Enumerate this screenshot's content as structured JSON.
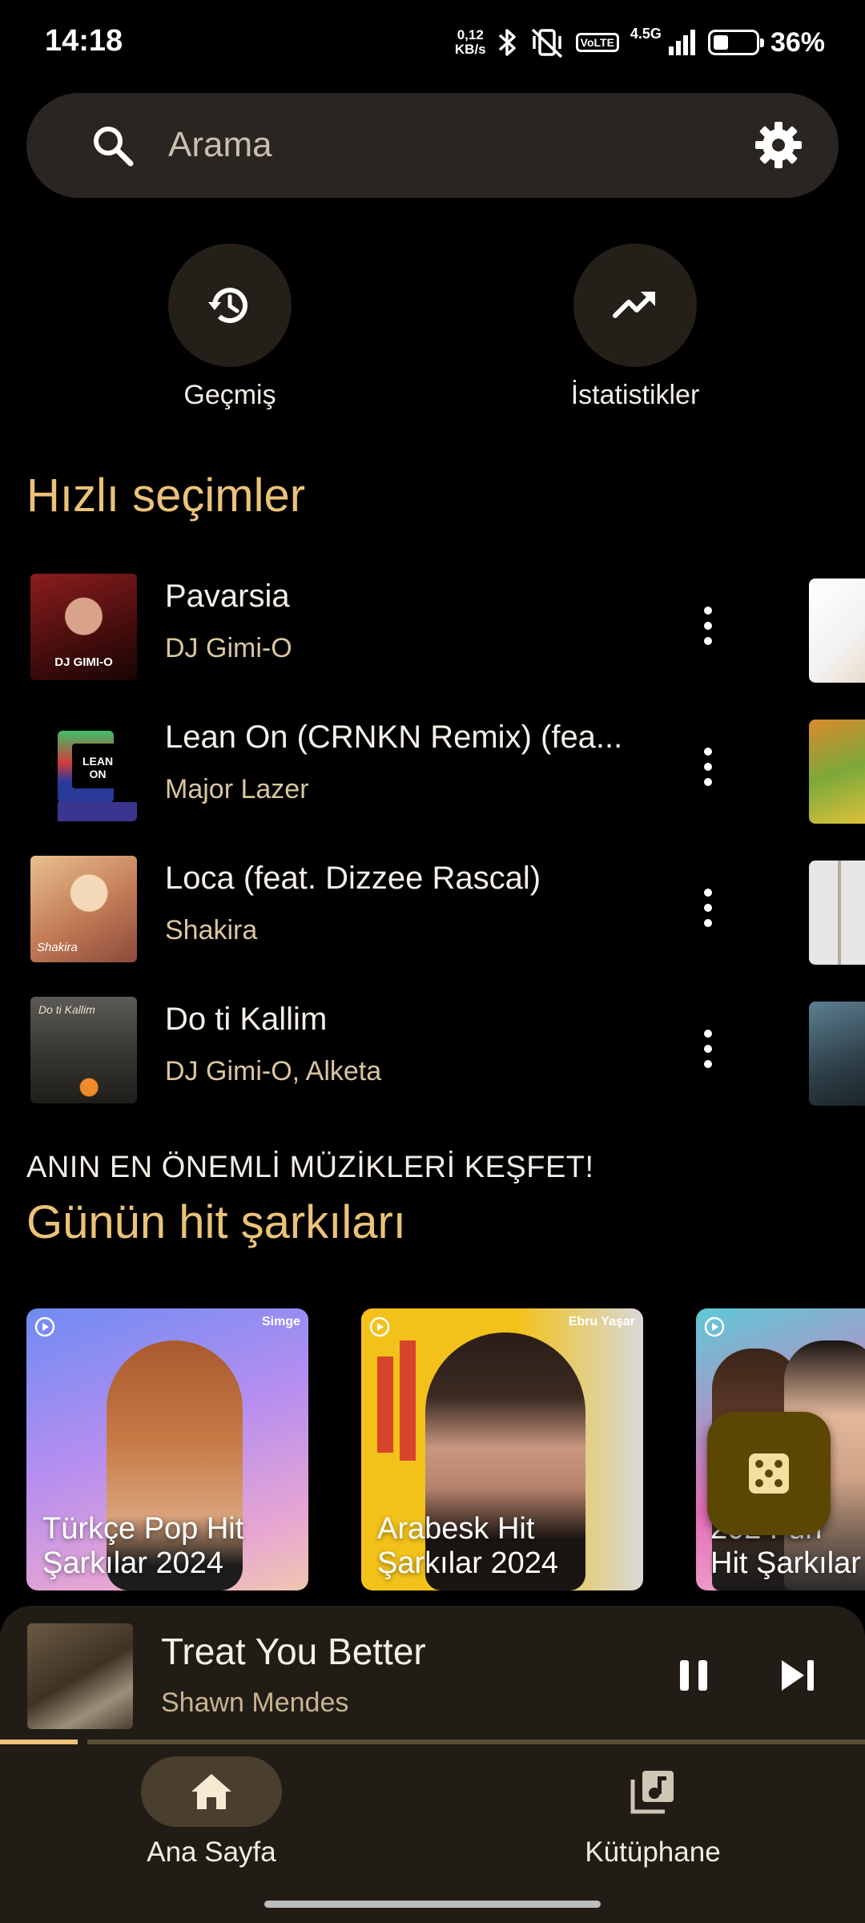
{
  "status_bar": {
    "time": "14:18",
    "net_speed_value": "0,12",
    "net_speed_unit": "KB/s",
    "volte_top": "Vo",
    "volte_bottom": "LTE",
    "network": "4.5G",
    "battery_percent": "36%",
    "battery_level": 0.36
  },
  "search": {
    "placeholder": "Arama"
  },
  "quick_actions": [
    {
      "label": "Geçmiş",
      "icon": "history-icon"
    },
    {
      "label": "İstatistikler",
      "icon": "trending-up-icon"
    }
  ],
  "quick_picks": {
    "title": "Hızlı seçimler",
    "items": [
      {
        "title": "Pavarsia",
        "artist": "DJ Gimi-O"
      },
      {
        "title": "Lean On (CRNKN Remix) (fea...",
        "artist": "Major Lazer"
      },
      {
        "title": "Loca (feat. Dizzee Rascal)",
        "artist": "Shakira"
      },
      {
        "title": "Do ti Kallim",
        "artist": "DJ Gimi-O, Alketa"
      }
    ]
  },
  "hits": {
    "kicker": "ANIN EN ÖNEMLİ MÜZİKLERİ KEŞFET!",
    "title": "Günün hit şarkıları",
    "cards": [
      {
        "title_line1": "Türkçe Pop Hit",
        "title_line2": "Şarkılar 2024",
        "artist": "Simge"
      },
      {
        "title_line1": "Arabesk Hit",
        "title_line2": "Şarkılar 2024",
        "artist": "Ebru Yaşar"
      },
      {
        "title_line1": "202 Fun",
        "title_line2": "Hit Şarkılar",
        "artist": ""
      }
    ]
  },
  "now_playing": {
    "title": "Treat You Better",
    "artist": "Shawn Mendes",
    "progress": 0.09
  },
  "bottom_nav": {
    "items": [
      {
        "label": "Ana Sayfa",
        "icon": "home-icon",
        "active": true
      },
      {
        "label": "Kütüphane",
        "icon": "library-music-icon",
        "active": false
      }
    ]
  },
  "colors": {
    "accent": "#ecc27a",
    "background": "#000000",
    "surface": "#211c16",
    "search_bg": "#2a2520",
    "fab": "#5c4603"
  }
}
